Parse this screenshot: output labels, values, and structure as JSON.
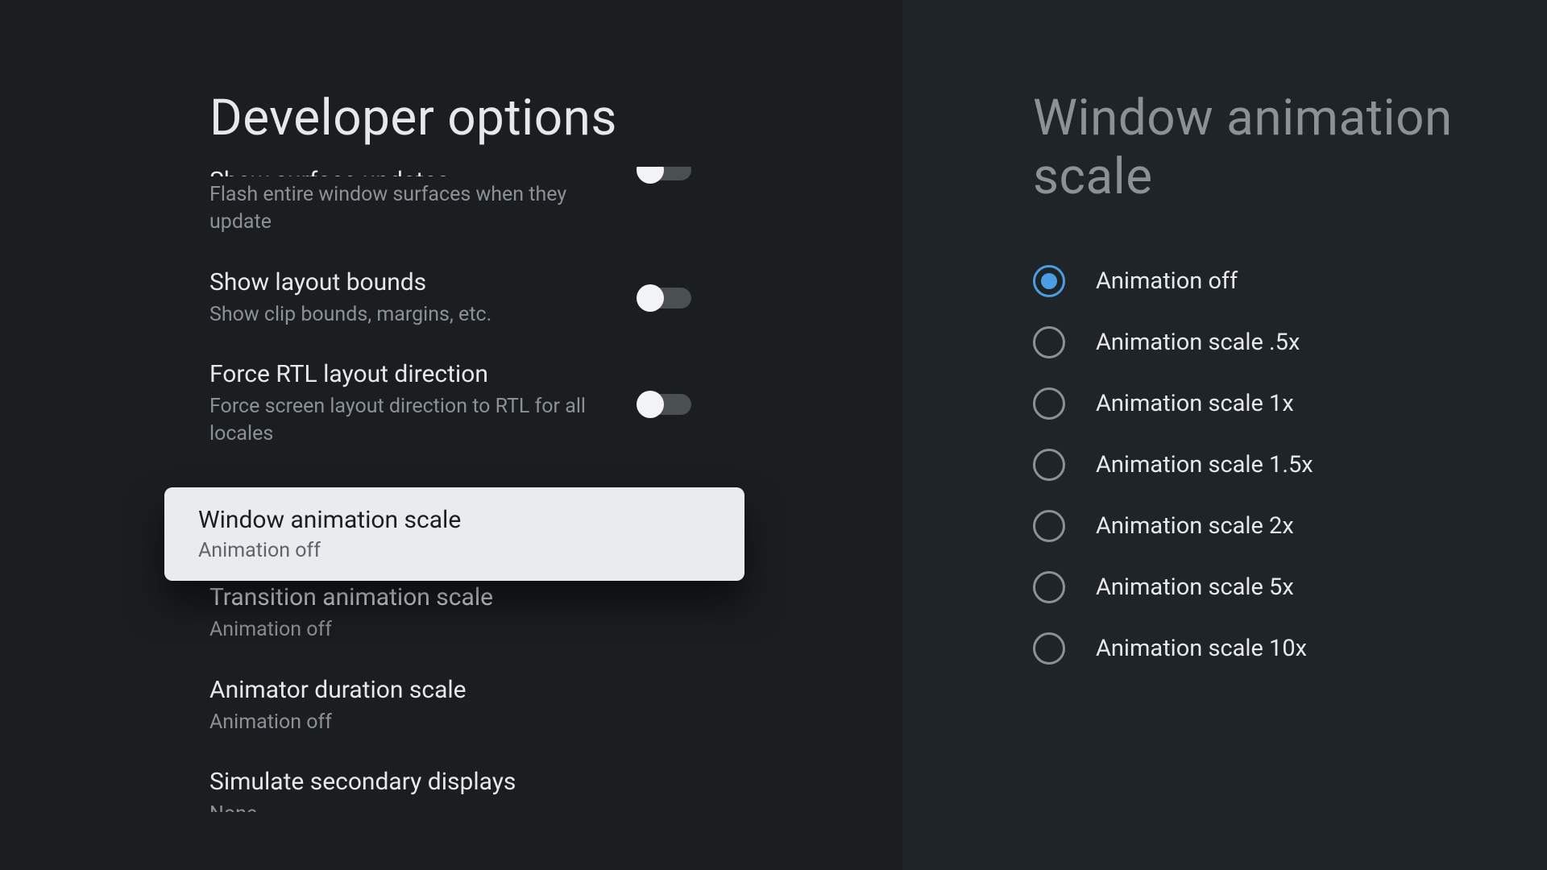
{
  "left": {
    "title": "Developer options",
    "items": [
      {
        "title": "Show surface updates",
        "sub": "Flash entire window surfaces when they update",
        "toggle": false
      },
      {
        "title": "Show layout bounds",
        "sub": "Show clip bounds, margins, etc.",
        "toggle": false
      },
      {
        "title": "Force RTL layout direction",
        "sub": "Force screen layout direction to RTL for all locales",
        "toggle": false
      },
      {
        "title": "Window animation scale",
        "sub": "Animation off"
      },
      {
        "title": "Transition animation scale",
        "sub": "Animation off"
      },
      {
        "title": "Animator duration scale",
        "sub": "Animation off"
      },
      {
        "title": "Simulate secondary displays",
        "sub": "None"
      }
    ],
    "selectedIndex": 3
  },
  "right": {
    "title": "Window animation scale",
    "options": [
      "Animation off",
      "Animation scale .5x",
      "Animation scale 1x",
      "Animation scale 1.5x",
      "Animation scale 2x",
      "Animation scale 5x",
      "Animation scale 10x"
    ],
    "selectedIndex": 0
  }
}
